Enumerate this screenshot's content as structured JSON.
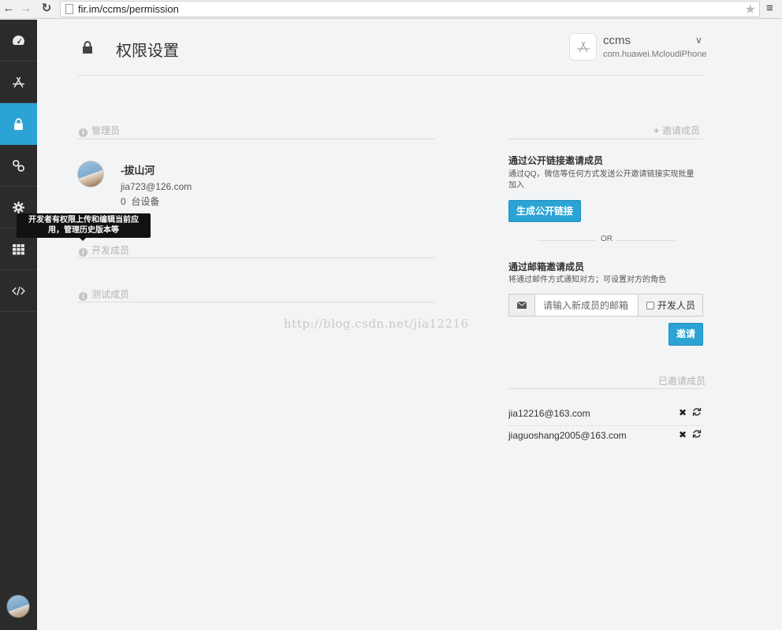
{
  "browser": {
    "url": "fir.im/ccms/permission",
    "icons": [
      "back-icon",
      "forward-icon",
      "reload-icon",
      "page-icon",
      "star-icon",
      "menu-icon"
    ]
  },
  "sidebar": {
    "items": [
      {
        "name": "dashboard",
        "icon": "dashboard-icon"
      },
      {
        "name": "apps",
        "icon": "app-store-icon"
      },
      {
        "name": "permission",
        "icon": "lock-icon",
        "active": true
      },
      {
        "name": "integrations",
        "icon": "link-icon"
      },
      {
        "name": "settings",
        "icon": "gear-icon"
      },
      {
        "name": "apps-grid",
        "icon": "grid-icon"
      },
      {
        "name": "developer",
        "icon": "code-icon"
      }
    ],
    "active_color": "#2ba3d4"
  },
  "tooltip": {
    "line1": "开发者有权限上传和编辑当前应",
    "line2": "用，管理历史版本等"
  },
  "header": {
    "title": "权限设置",
    "app_name": "ccms",
    "app_bundle": "com.huawei.McloudiPhone"
  },
  "sections": {
    "admins": "管理员",
    "developers": "开发成员",
    "testers": "测试成员",
    "invite": "邀请成员",
    "invited": "已邀请成员"
  },
  "admin": {
    "name": "-拔山河",
    "email": "jia723@126.com",
    "device_count": "0",
    "device_label": "台设备"
  },
  "invite": {
    "link_title": "通过公开链接邀请成员",
    "link_desc_line1": "通过QQ，微信等任何方式发送公开邀请链接实现批量",
    "link_desc_line2": "加入",
    "link_button": "生成公开链接",
    "or": "OR",
    "email_title": "通过邮箱邀请成员",
    "email_desc": "将通过邮件方式通知对方；可设置对方的角色",
    "email_placeholder": "请输入新成员的邮箱",
    "developer_checkbox": "开发人员",
    "invite_button": "邀请"
  },
  "invited": [
    {
      "email": "jia12216@163.com"
    },
    {
      "email": "jiaguoshang2005@163.com"
    }
  ],
  "watermark": "http://blog.csdn.net/jia12216"
}
